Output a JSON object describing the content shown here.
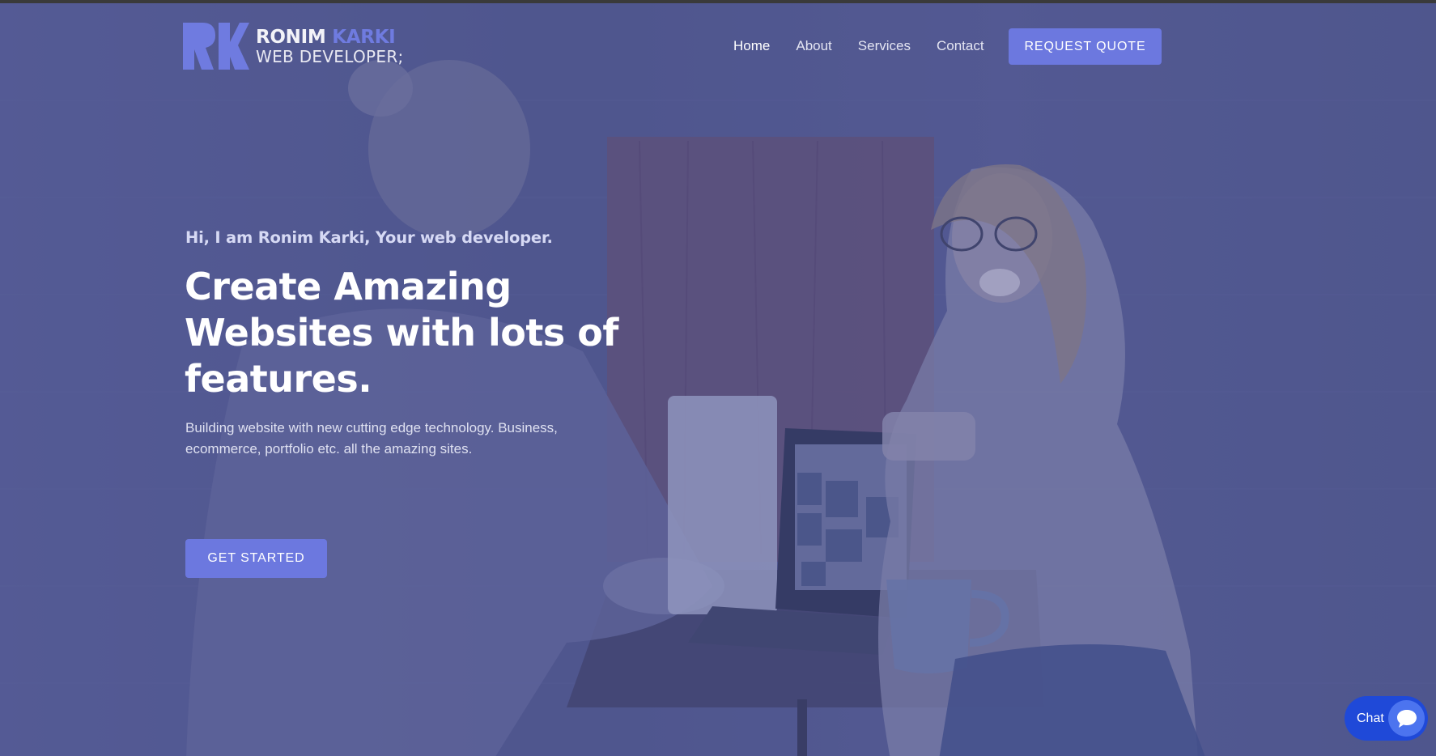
{
  "logo": {
    "name_first": "RONIM",
    "name_last": "KARKI",
    "tagline": "WEB DEVELOPER;",
    "mark_color": "#6f7be0"
  },
  "nav": {
    "items": [
      {
        "label": "Home",
        "active": true
      },
      {
        "label": "About",
        "active": false
      },
      {
        "label": "Services",
        "active": false
      },
      {
        "label": "Contact",
        "active": false
      }
    ],
    "cta_label": "REQUEST QUOTE"
  },
  "hero": {
    "greeting": "Hi, I am Ronim Karki, Your web developer.",
    "title": "Create Amazing Websites with lots of features.",
    "description": "Building website with new cutting edge technology. Business, ecommerce, portfolio etc. all the amazing sites.",
    "cta_label": "GET STARTED"
  },
  "chat": {
    "label": "Chat",
    "icon": "speech-bubble-icon"
  },
  "colors": {
    "accent": "#6c78df",
    "overlay": "#4a5290",
    "chat": "#1f49d8"
  }
}
